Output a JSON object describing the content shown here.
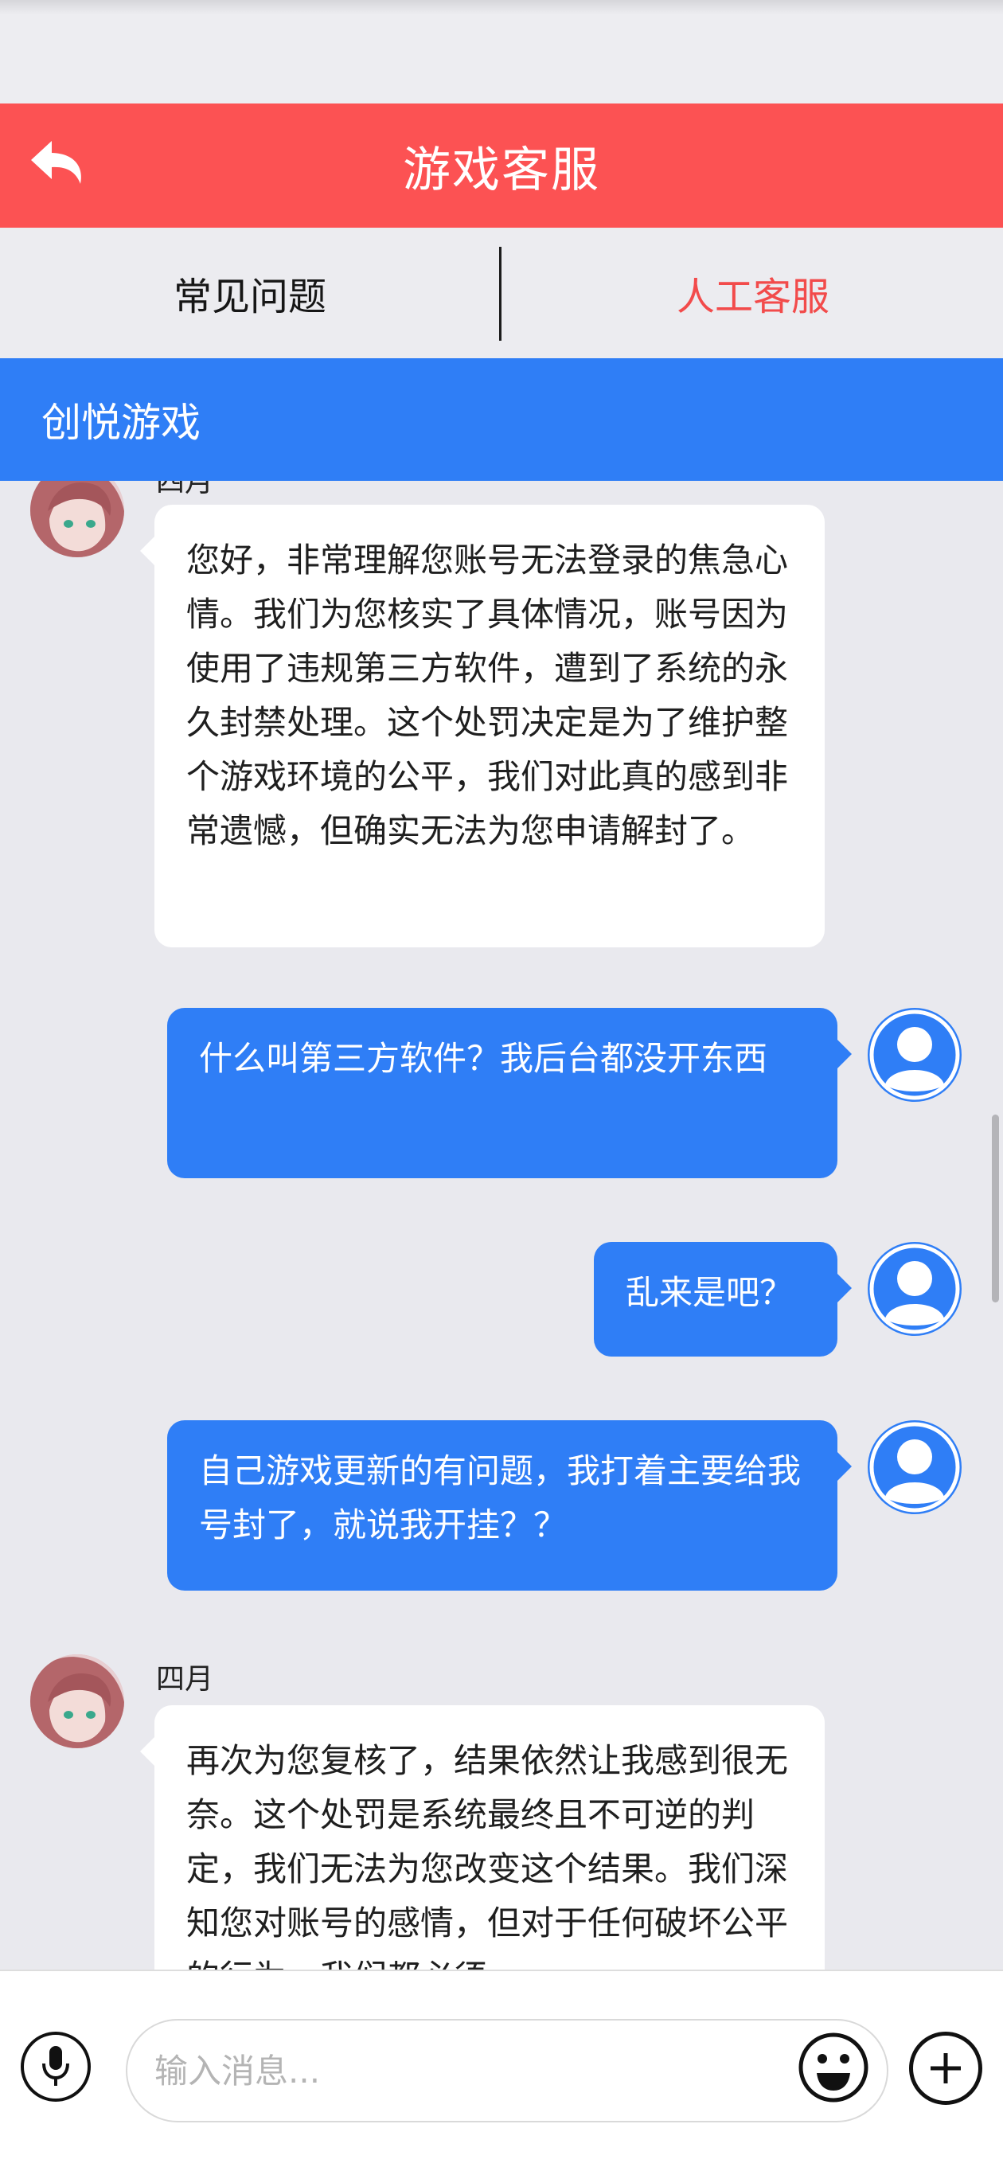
{
  "header": {
    "title": "游戏客服",
    "back_icon": "back-arrow-icon"
  },
  "tabs": [
    {
      "label": "常见问题",
      "active": false
    },
    {
      "label": "人工客服",
      "active": true
    }
  ],
  "group": {
    "name": "创悦游戏"
  },
  "messages": [
    {
      "from": "agent",
      "sender": "四月",
      "text": "您好，非常理解您账号无法登录的焦急心情。我们为您核实了具体情况，账号因为使用了违规第三方软件，遭到了系统的永久封禁处理。这个处罚决定是为了维护整个游戏环境的公平，我们对此真的感到非常遗憾，但确实无法为您申请解封了。"
    },
    {
      "from": "user",
      "text": "什么叫第三方软件？我后台都没开东西"
    },
    {
      "from": "user",
      "text": "乱来是吧？"
    },
    {
      "from": "user",
      "text": "自己游戏更新的有问题，我打着主要给我号封了，就说我开挂？？"
    },
    {
      "from": "agent",
      "sender": "四月",
      "text": "再次为您复核了，结果依然让我感到很无奈。这个处罚是系统最终且不可逆的判定，我们无法为您改变这个结果。我们深知您对账号的感情，但对于任何破坏公平的行为，我们都必须"
    }
  ],
  "input": {
    "placeholder": "输入消息...",
    "value": ""
  },
  "icons": {
    "mic": "microphone-icon",
    "emoji": "emoji-icon",
    "plus": "plus-icon",
    "user_avatar": "user-avatar-icon"
  },
  "colors": {
    "title_bar": "#fc5253",
    "accent_blue": "#2f7ef6",
    "active_tab": "#f24b4b"
  }
}
